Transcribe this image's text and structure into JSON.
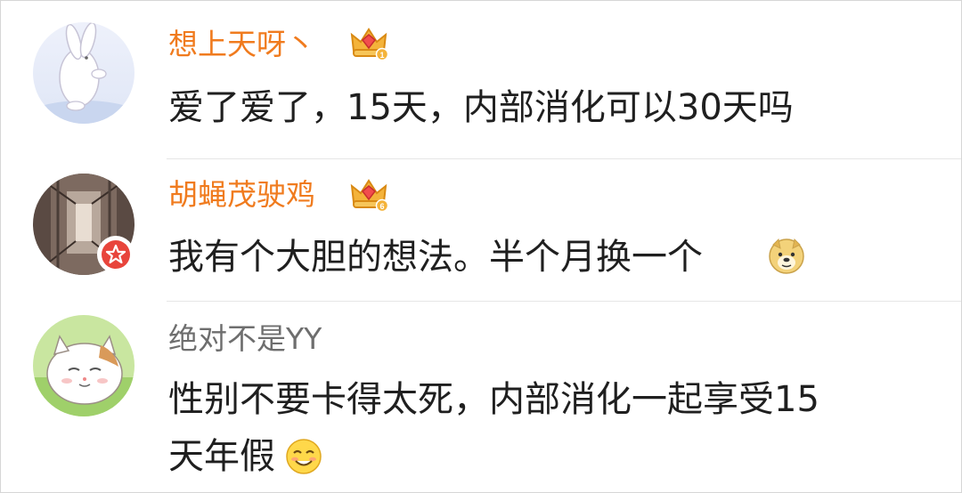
{
  "comments": [
    {
      "username": "想上天呀丶",
      "vip_level": "1",
      "text": "爱了爱了，15天，内部消化可以30天吗"
    },
    {
      "username": "胡蝇茂驶鸡",
      "vip_level": "6",
      "text": "我有个大胆的想法。半个月换一个"
    },
    {
      "username": "绝对不是YY",
      "text_line1": "性别不要卡得太死，内部消化一起享受15",
      "text_line2": "天年假"
    }
  ],
  "colors": {
    "vip_name": "#f07b1e",
    "normal_name": "#6e6e6e",
    "text": "#1f1f1f",
    "divider": "#e6e6e6"
  }
}
